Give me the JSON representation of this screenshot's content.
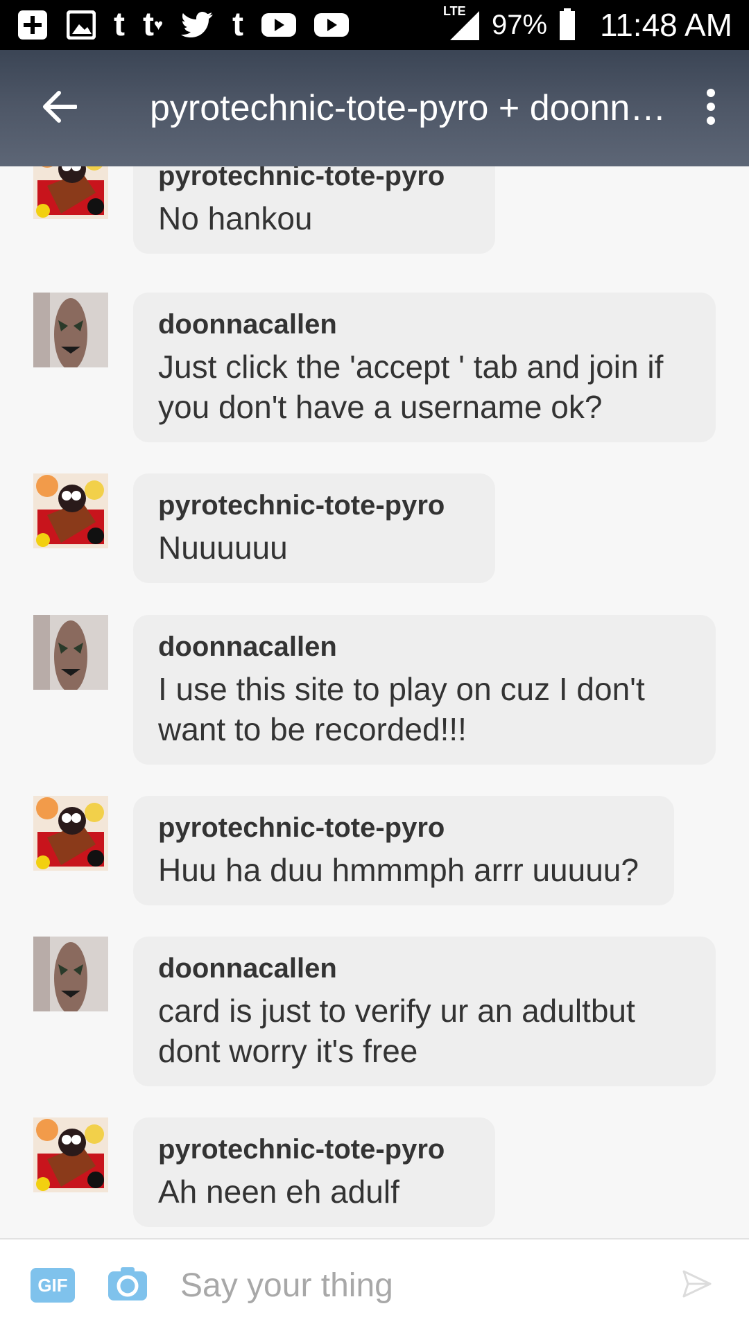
{
  "status_bar": {
    "network": "LTE",
    "battery": "97%",
    "time": "11:48 AM",
    "icons": [
      "add-box-icon",
      "image-icon",
      "tumblr-icon",
      "tumblr-heart-icon",
      "twitter-icon",
      "tumblr-icon",
      "youtube-icon",
      "youtube-icon",
      "signal-icon",
      "battery-icon"
    ]
  },
  "header": {
    "title": "pyrotechnic-tote-pyro + doonnacallen",
    "back_icon": "arrow-left-icon",
    "menu_icon": "more-vert-icon"
  },
  "messages": [
    {
      "sender": "pyrotechnic-tote-pyro",
      "text": "No hankou"
    },
    {
      "sender": "doonnacallen",
      "text": "Just click the 'accept ' tab and join if you don't have a username ok?"
    },
    {
      "sender": "pyrotechnic-tote-pyro",
      "text": "Nuuuuuu"
    },
    {
      "sender": "doonnacallen",
      "text": "I use this site to play on cuz I don't want to be recorded!!!"
    },
    {
      "sender": "pyrotechnic-tote-pyro",
      "text": "Huu ha duu hmmmph arrr uuuuu?"
    },
    {
      "sender": "doonnacallen",
      "text": "card is just to verify ur an adultbut dont worry it's  free"
    },
    {
      "sender": "pyrotechnic-tote-pyro",
      "text": "Ah neen eh adulf"
    }
  ],
  "composer": {
    "gif_label": "GIF",
    "placeholder": "Say your thing",
    "camera_icon": "camera-icon",
    "send_icon": "send-icon"
  },
  "colors": {
    "bubble": "#eeeeee",
    "background": "#f7f7f7",
    "accent": "#7fc2ec"
  }
}
